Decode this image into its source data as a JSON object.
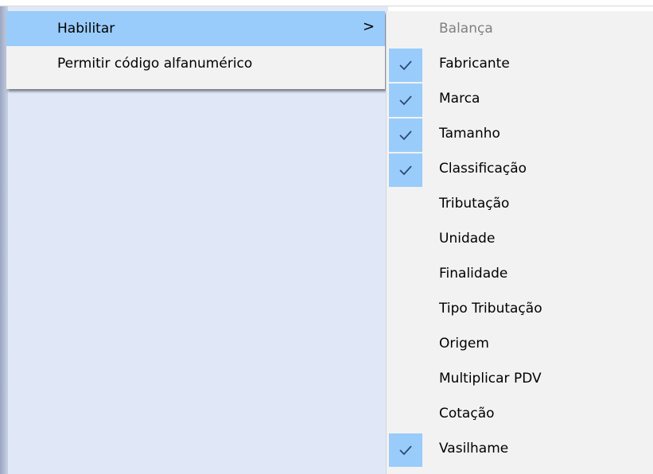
{
  "primary_menu": {
    "items": [
      {
        "label": "Habilitar",
        "highlighted": true,
        "has_submenu": true,
        "arrow": ">"
      },
      {
        "label": "Permitir código alfanumérico",
        "highlighted": false,
        "has_submenu": false
      }
    ]
  },
  "submenu": {
    "items": [
      {
        "label": "Balança",
        "checked": false,
        "disabled": true
      },
      {
        "label": "Fabricante",
        "checked": true,
        "disabled": false
      },
      {
        "label": "Marca",
        "checked": true,
        "disabled": false
      },
      {
        "label": "Tamanho",
        "checked": true,
        "disabled": false
      },
      {
        "label": "Classificação",
        "checked": true,
        "disabled": false
      },
      {
        "label": "Tributação",
        "checked": false,
        "disabled": false
      },
      {
        "label": "Unidade",
        "checked": false,
        "disabled": false
      },
      {
        "label": "Finalidade",
        "checked": false,
        "disabled": false
      },
      {
        "label": "Tipo Tributação",
        "checked": false,
        "disabled": false
      },
      {
        "label": "Origem",
        "checked": false,
        "disabled": false
      },
      {
        "label": "Multiplicar PDV",
        "checked": false,
        "disabled": false
      },
      {
        "label": "Cotação",
        "checked": false,
        "disabled": false
      },
      {
        "label": "Vasilhame",
        "checked": true,
        "disabled": false
      }
    ]
  },
  "colors": {
    "highlight": "#99ccfb",
    "menu_bg": "#f2f2f2",
    "disabled_text": "#808080",
    "check_mark": "#2b4a74",
    "window_bg": "#e0e8f8"
  },
  "icons": {
    "check": "check-icon",
    "submenu_arrow": "chevron-right-icon"
  }
}
